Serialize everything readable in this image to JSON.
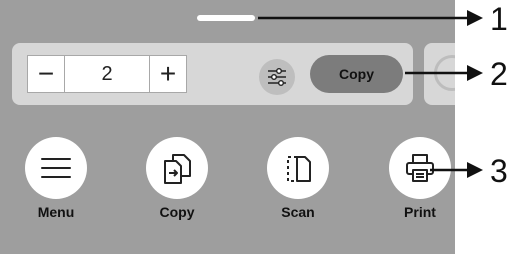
{
  "copy_stepper": {
    "minus": "−",
    "value": "2",
    "plus": "+"
  },
  "copy_button": {
    "label": "Copy"
  },
  "apps": [
    {
      "label": "Menu"
    },
    {
      "label": "Copy"
    },
    {
      "label": "Scan"
    },
    {
      "label": "Print"
    }
  ],
  "callouts": [
    "1",
    "2",
    "3"
  ],
  "icons": {
    "settings": "sliders-icon",
    "menu": "hamburger-menu-icon",
    "copy": "copy-document-icon",
    "scan": "scan-document-icon",
    "print": "printer-icon"
  },
  "colors": {
    "screen_background": "#9e9e9e",
    "panel_background": "#d7d7d7",
    "copy_button": "#7c7c7c"
  }
}
